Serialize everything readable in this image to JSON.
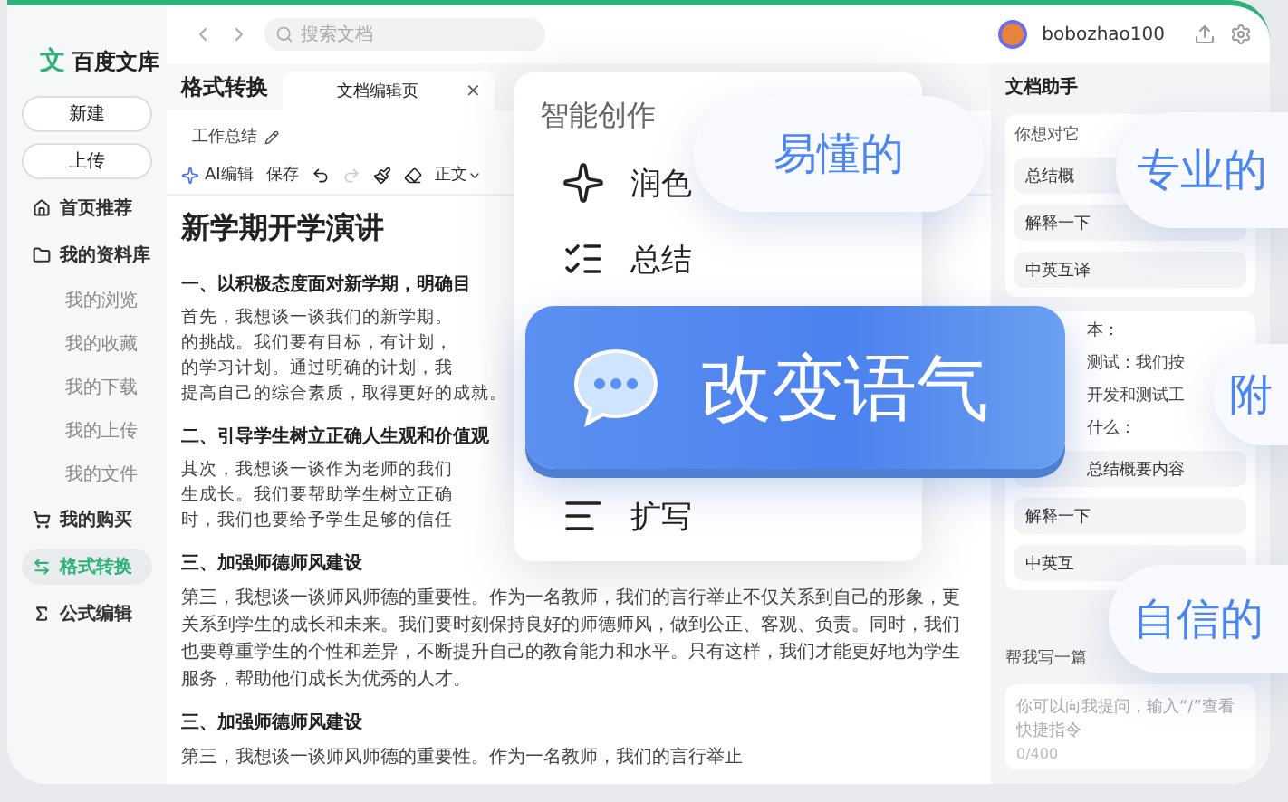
{
  "sidebar": {
    "logo_mark": "文",
    "logo": "百度文库",
    "buttons": [
      "新建",
      "上传"
    ],
    "nav": [
      {
        "label": "首页推荐",
        "kind": "main",
        "selected": false
      },
      {
        "label": "我的资料库",
        "kind": "main",
        "selected": false
      },
      {
        "label": "我的浏览",
        "kind": "sub",
        "selected": false
      },
      {
        "label": "我的收藏",
        "kind": "sub",
        "selected": false
      },
      {
        "label": "我的下载",
        "kind": "sub",
        "selected": false
      },
      {
        "label": "我的上传",
        "kind": "sub",
        "selected": false
      },
      {
        "label": "我的文件",
        "kind": "sub",
        "selected": false
      },
      {
        "label": "我的购买",
        "kind": "main",
        "selected": false
      },
      {
        "label": "格式转换",
        "kind": "main",
        "selected": true
      },
      {
        "label": "公式编辑",
        "kind": "main",
        "selected": false
      }
    ]
  },
  "topbar": {
    "search": {
      "placeholder": "搜索文档"
    },
    "user": "bobozhao100"
  },
  "page_title": "格式转换",
  "tabs": [
    {
      "label": "文档编辑页",
      "selected": true,
      "close": "×"
    }
  ],
  "breadcrumb": "工作总结",
  "toolbar": {
    "ai": "AI编辑",
    "save": "保存",
    "redo_disabled": true,
    "style": "正文"
  },
  "document": {
    "title": "新学期开学演讲",
    "blocks": [
      {
        "kind": "heading",
        "text": "一、以积极态度面对新学期，明确目"
      },
      {
        "kind": "lines",
        "lines": [
          {
            "text": "首先，我想谈一谈我们的新学期。"
          },
          {
            "text": "的挑战。我们要有目标，有计划，"
          },
          {
            "text": "的学习计划。通过明确的计划，我"
          },
          {
            "text": "提高自己的综合素质，取得更好的成就。"
          }
        ]
      },
      {
        "kind": "heading",
        "text": "二、引导学生树立正确人生观和价值观"
      },
      {
        "kind": "lines",
        "lines": [
          {
            "text": "其次，我想谈一谈作为老师的我们"
          },
          {
            "text": "生成长。我们要帮助学生树立正确"
          },
          {
            "text": "时，我们也要给予学生足够的信任"
          }
        ]
      },
      {
        "kind": "heading",
        "text": "三、加强师德师风建设"
      },
      {
        "kind": "para",
        "text": "第三，我想谈一谈师风师德的重要性。作为一名教师，我们的言行举止不仅关系到自己的形象，更关系到学生的成长和未来。我们要时刻保持良好的师德师风，做到公正、客观、负责。同时，我们也要尊重学生的个性和差异，不断提升自己的教育能力和水平。只有这样，我们才能更好地为学生服务，帮助他们成长为优秀的人才。"
      },
      {
        "kind": "heading",
        "text": "三、加强师德师风建设"
      },
      {
        "kind": "para",
        "text": "第三，我想谈一谈师风师德的重要性。作为一名教师，我们的言行举止"
      }
    ]
  },
  "assistant": {
    "title": "文档助手",
    "prompt": "你想对它",
    "chips": [
      "总结概",
      "解释一下",
      "中英互译"
    ],
    "card": {
      "lines": [
        "本：",
        "测试：我们按",
        "开发和测试工",
        "什么："
      ],
      "chips": [
        "总结概要内容",
        "解释一下",
        "中英互"
      ]
    },
    "composer": {
      "label": "帮我写一篇",
      "placeholder": "你可以向我提问，输入“/”查看快捷指令",
      "counter": "0/400"
    }
  },
  "menu": {
    "title": "智能创作",
    "items": [
      {
        "label": "润色",
        "selected": false
      },
      {
        "label": "总结",
        "selected": false
      },
      {
        "label": "改变语气",
        "selected": true
      },
      {
        "label": "扩写",
        "selected": false
      }
    ]
  },
  "tones": [
    {
      "label": "易懂的"
    },
    {
      "label": "专业的"
    },
    {
      "label": "附"
    },
    {
      "label": "自信的"
    }
  ]
}
